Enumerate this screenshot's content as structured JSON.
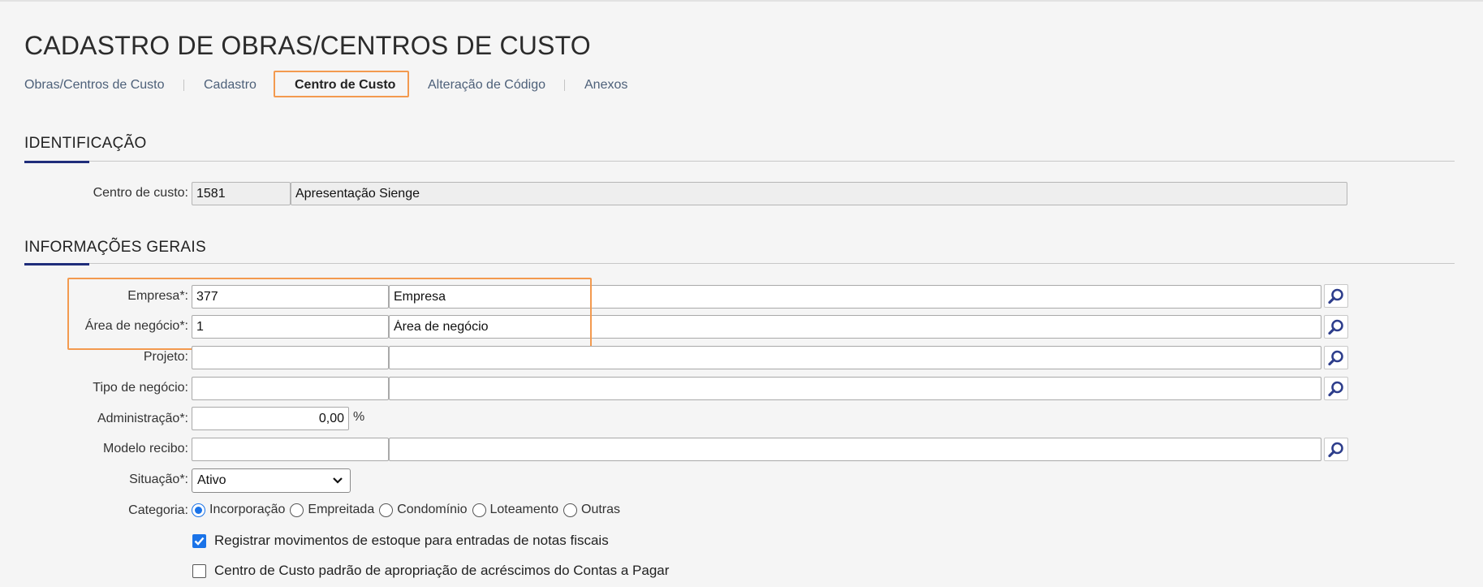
{
  "page": {
    "title": "CADASTRO DE OBRAS/CENTROS DE CUSTO"
  },
  "tabs": [
    {
      "label": "Obras/Centros de Custo",
      "active": false
    },
    {
      "label": "Cadastro",
      "active": false
    },
    {
      "label": "Centro de Custo",
      "active": true
    },
    {
      "label": "Alteração de Código",
      "active": false
    },
    {
      "label": "Anexos",
      "active": false
    }
  ],
  "identificacao": {
    "title": "IDENTIFICAÇÃO",
    "centro_custo": {
      "label": "Centro de custo:",
      "code": "1581",
      "name": "Apresentação Sienge"
    }
  },
  "informacoes": {
    "title": "INFORMAÇÕES GERAIS",
    "empresa": {
      "label": "Empresa*:",
      "code": "377",
      "name": "Empresa"
    },
    "area_negocio": {
      "label": "Área de negócio*:",
      "code": "1",
      "name": "Área de negócio"
    },
    "projeto": {
      "label": "Projeto:",
      "code": "",
      "name": ""
    },
    "tipo_negocio": {
      "label": "Tipo de negócio:",
      "code": "",
      "name": ""
    },
    "administracao": {
      "label": "Administração*:",
      "value": "0,00",
      "unit": "%"
    },
    "modelo_recibo": {
      "label": "Modelo recibo:",
      "code": "",
      "name": ""
    },
    "situacao": {
      "label": "Situação*:",
      "value": "Ativo"
    },
    "categoria": {
      "label": "Categoria:",
      "options": [
        "Incorporação",
        "Empreitada",
        "Condomínio",
        "Loteamento",
        "Outras"
      ],
      "selected": "Incorporação"
    },
    "registrar_estoque": {
      "label": "Registrar movimentos de estoque para entradas de notas fiscais",
      "checked": true
    },
    "cc_padrao": {
      "label": "Centro de Custo padrão de apropriação de acréscimos do Contas a Pagar",
      "checked": false
    }
  },
  "colors": {
    "accent": "#1f2d7a",
    "highlight": "#f39a4f",
    "radio_selected": "#1a73e8",
    "tab_text": "#4d6079"
  },
  "icons": {
    "lookup": "search-icon",
    "select": "chevron-down-icon",
    "check": "checkmark-icon"
  }
}
